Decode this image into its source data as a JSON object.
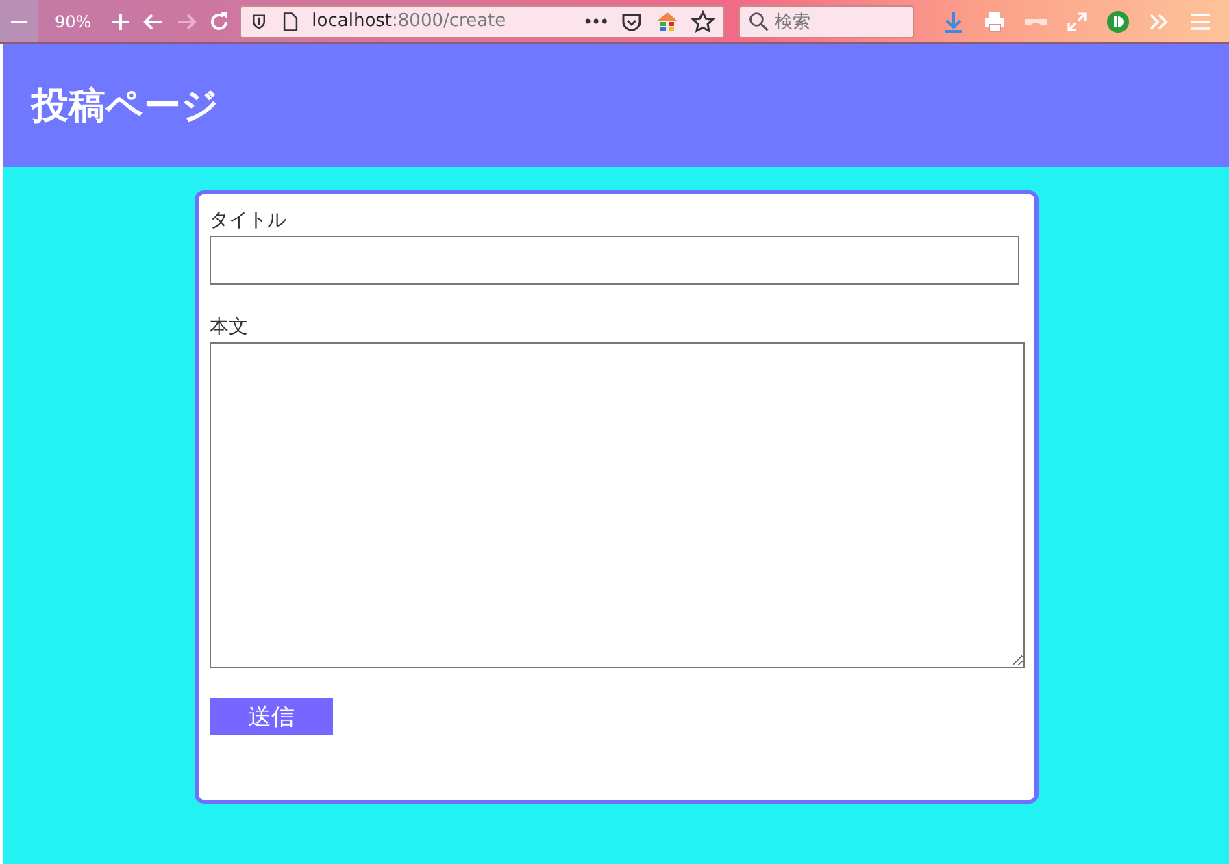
{
  "browser": {
    "zoom": "90%",
    "forward_disabled": true,
    "url_host": "localhost",
    "url_path": ":8000/create",
    "page_actions": "•••",
    "search": {
      "placeholder": "検索"
    }
  },
  "header": {
    "title": "投稿ページ"
  },
  "form": {
    "fields": [
      {
        "kind": "input",
        "label": "タイトル"
      },
      {
        "kind": "textarea",
        "label": "本文"
      }
    ],
    "submit": "送信"
  }
}
